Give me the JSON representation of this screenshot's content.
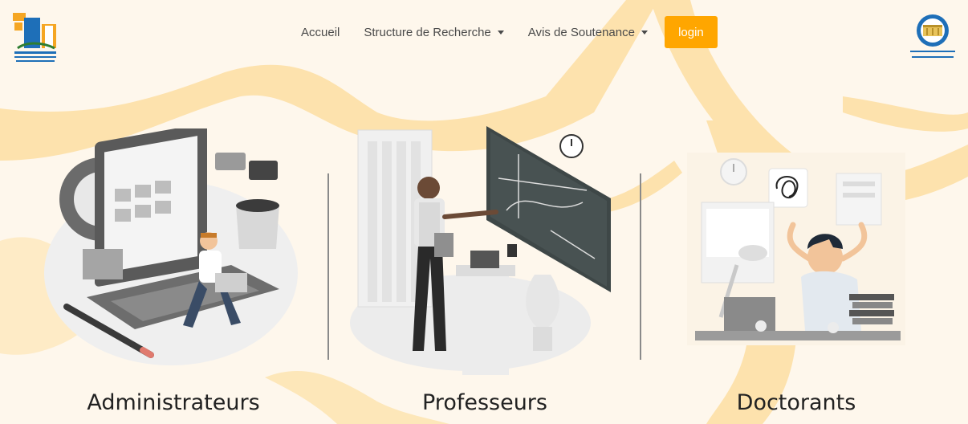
{
  "nav": {
    "home": "Accueil",
    "research": "Structure de Recherche",
    "defense": "Avis de Soutenance",
    "login": "login"
  },
  "logos": {
    "left_alt": "جامعة السلطان مولاي سليمان",
    "right_alt": "Faculté Polydisciplinaire - Beni Mellal"
  },
  "roles": [
    {
      "label": "Administrateurs"
    },
    {
      "label": "Professeurs"
    },
    {
      "label": "Doctorants"
    }
  ],
  "colors": {
    "background": "#fef7ec",
    "accent_shape": "#fde2ad",
    "login_button": "#ffa600"
  }
}
